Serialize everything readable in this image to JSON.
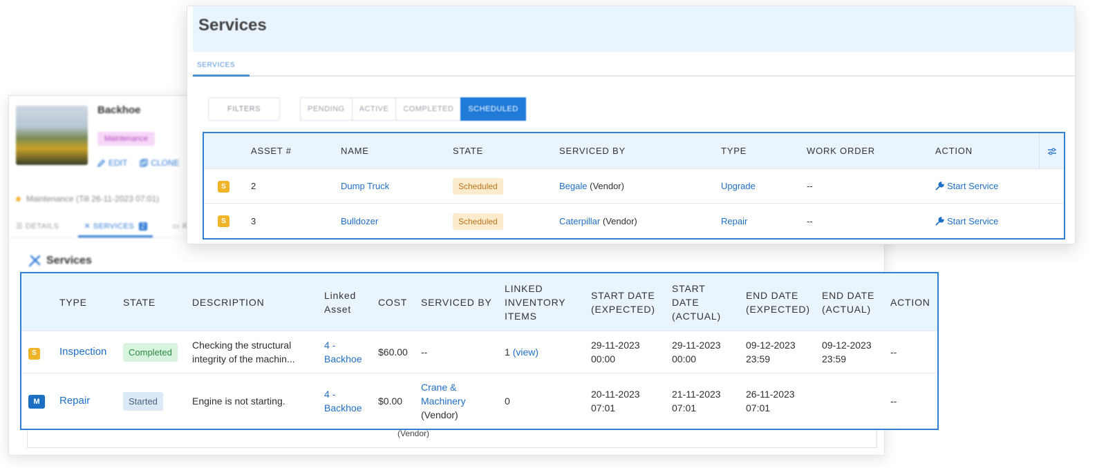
{
  "asset_panel": {
    "title": "Backhoe",
    "badge": "Maintenance",
    "actions": {
      "edit": "EDIT",
      "clone": "CLONE"
    },
    "status_line": "Maintenance (Till 26-11-2023 07:01)",
    "tabs": {
      "details": "DETAILS",
      "services": "SERVICES",
      "services_count": "2",
      "more": "RE"
    },
    "services_heading": "Services",
    "overflow_text": "(Vendor)"
  },
  "services_window": {
    "title": "Services",
    "tab_label": "SERVICES",
    "filters_label": "FILTERS",
    "state_buttons": [
      "PENDING",
      "ACTIVE",
      "COMPLETED",
      "SCHEDULED"
    ],
    "active_state": "SCHEDULED",
    "columns": [
      "ASSET #",
      "NAME",
      "STATE",
      "SERVICED BY",
      "TYPE",
      "WORK ORDER",
      "ACTION"
    ],
    "rows": [
      {
        "badge": "S",
        "asset": "2",
        "name": "Dump Truck",
        "state": "Scheduled",
        "serviced_by": "Begale",
        "serviced_suffix": "(Vendor)",
        "type": "Upgrade",
        "work_order": "--",
        "action": "Start Service"
      },
      {
        "badge": "S",
        "asset": "3",
        "name": "Bulldozer",
        "state": "Scheduled",
        "serviced_by": "Caterpillar",
        "serviced_suffix": "(Vendor)",
        "type": "Repair",
        "work_order": "--",
        "action": "Start Service"
      }
    ]
  },
  "asset_services_table": {
    "columns": {
      "type": "TYPE",
      "state": "STATE",
      "description": "DESCRIPTION",
      "linked_asset_1": "Linked",
      "linked_asset_2": "Asset",
      "cost": "COST",
      "serviced_by": "SERVICED BY",
      "inventory_1": "LINKED",
      "inventory_2": "INVENTORY",
      "inventory_3": "ITEMS",
      "start_exp_1": "START DATE",
      "start_exp_2": "(EXPECTED)",
      "start_act_1": "START",
      "start_act_2": "DATE",
      "start_act_3": "(ACTUAL)",
      "end_exp_1": "END DATE",
      "end_exp_2": "(EXPECTED)",
      "end_act_1": "END DATE",
      "end_act_2": "(ACTUAL)",
      "action": "ACTION"
    },
    "rows": [
      {
        "badge": "S",
        "type": "Inspection",
        "state": "Completed",
        "description_1": "Checking the structural",
        "description_2": "integrity of the machin...",
        "linked_1": "4 -",
        "linked_2": "Backhoe",
        "cost": "$60.00",
        "serviced_by": "--",
        "inventory_count": "1",
        "inventory_link": "(view)",
        "start_exp_date": "29-11-2023",
        "start_exp_time": "00:00",
        "start_act_date": "29-11-2023",
        "start_act_time": "00:00",
        "end_exp_date": "09-12-2023",
        "end_exp_time": "23:59",
        "end_act_date": "09-12-2023",
        "end_act_time": "23:59",
        "action": "--"
      },
      {
        "badge": "M",
        "type": "Repair",
        "state": "Started",
        "description_1": "Engine is not starting.",
        "linked_1": "4 -",
        "linked_2": "Backhoe",
        "cost": "$0.00",
        "serviced_by_1": "Crane &",
        "serviced_by_2": "Machinery",
        "serviced_by_3": "(Vendor)",
        "inventory_count": "0",
        "start_exp_date": "20-11-2023",
        "start_exp_time": "07:01",
        "start_act_date": "21-11-2023",
        "start_act_time": "07:01",
        "end_exp_date": "26-11-2023",
        "end_exp_time": "07:01",
        "action": "--"
      }
    ]
  },
  "colors": {
    "primary_blue": "#1f7ad8",
    "header_bg": "#eaf4fc",
    "scheduled_bg": "#fdebcd",
    "completed_bg": "#d8f3de",
    "started_bg": "#dbe9f6",
    "badge_s": "#f0b429",
    "badge_m": "#1d6fc4"
  }
}
